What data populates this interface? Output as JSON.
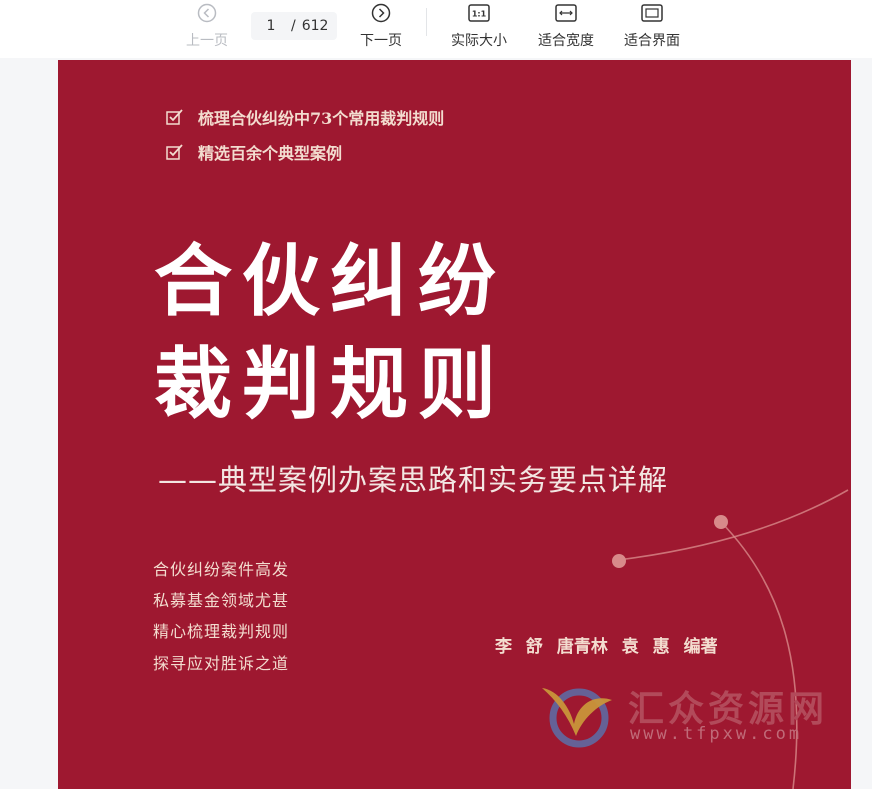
{
  "toolbar": {
    "prev_label": "上一页",
    "next_label": "下一页",
    "current_page": "1",
    "separator": "/",
    "total_pages": "612",
    "actual_size_label": "实际大小",
    "actual_size_icon_text": "1:1",
    "fit_width_label": "适合宽度",
    "fit_page_label": "适合界面"
  },
  "cover": {
    "bullets": [
      "梳理合伙纠纷中73个常用裁判规则",
      "精选百余个典型案例"
    ],
    "title_line1": "合伙纠纷",
    "title_line2": "裁判规则",
    "subtitle": "——典型案例办案思路和实务要点详解",
    "slogans": [
      "合伙纠纷案件高发",
      "私募基金领域尤甚",
      "精心梳理裁判规则",
      "探寻应对胜诉之道"
    ],
    "authors": "李 舒 唐青林 袁 惠 编著",
    "cover_color": "#9e1830"
  },
  "watermark": {
    "title": "汇众资源网",
    "url": "www.tfpxw.com"
  }
}
